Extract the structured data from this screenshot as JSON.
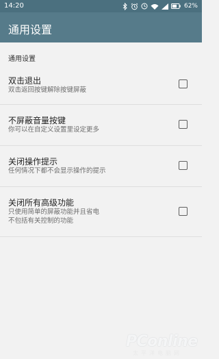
{
  "status_bar": {
    "time": "14:20",
    "battery_percent": "62%",
    "icons": [
      "bluetooth-icon",
      "alarm-icon",
      "clock-icon",
      "wifi-icon",
      "cell-signal-icon",
      "battery-icon"
    ]
  },
  "app_bar": {
    "title": "通用设置",
    "background": "#567b8a"
  },
  "section": {
    "header": "通用设置"
  },
  "settings": [
    {
      "title": "双击退出",
      "subtitle": "双击返回按键解除按键屏蔽",
      "checked": false
    },
    {
      "title": "不屏蔽音量按键",
      "subtitle": "你可以在自定义设置里设定更多",
      "checked": false
    },
    {
      "title": "关闭操作提示",
      "subtitle": "任何情况下都不会显示操作的提示",
      "checked": false
    },
    {
      "title": "关闭所有高级功能",
      "subtitle_line1": "只使用简单的屏蔽功能并且省电",
      "subtitle_line2": "不包括有关控制的功能",
      "checked": false
    }
  ],
  "watermark": {
    "brand": "PConline",
    "sub": "太平洋电脑网"
  }
}
